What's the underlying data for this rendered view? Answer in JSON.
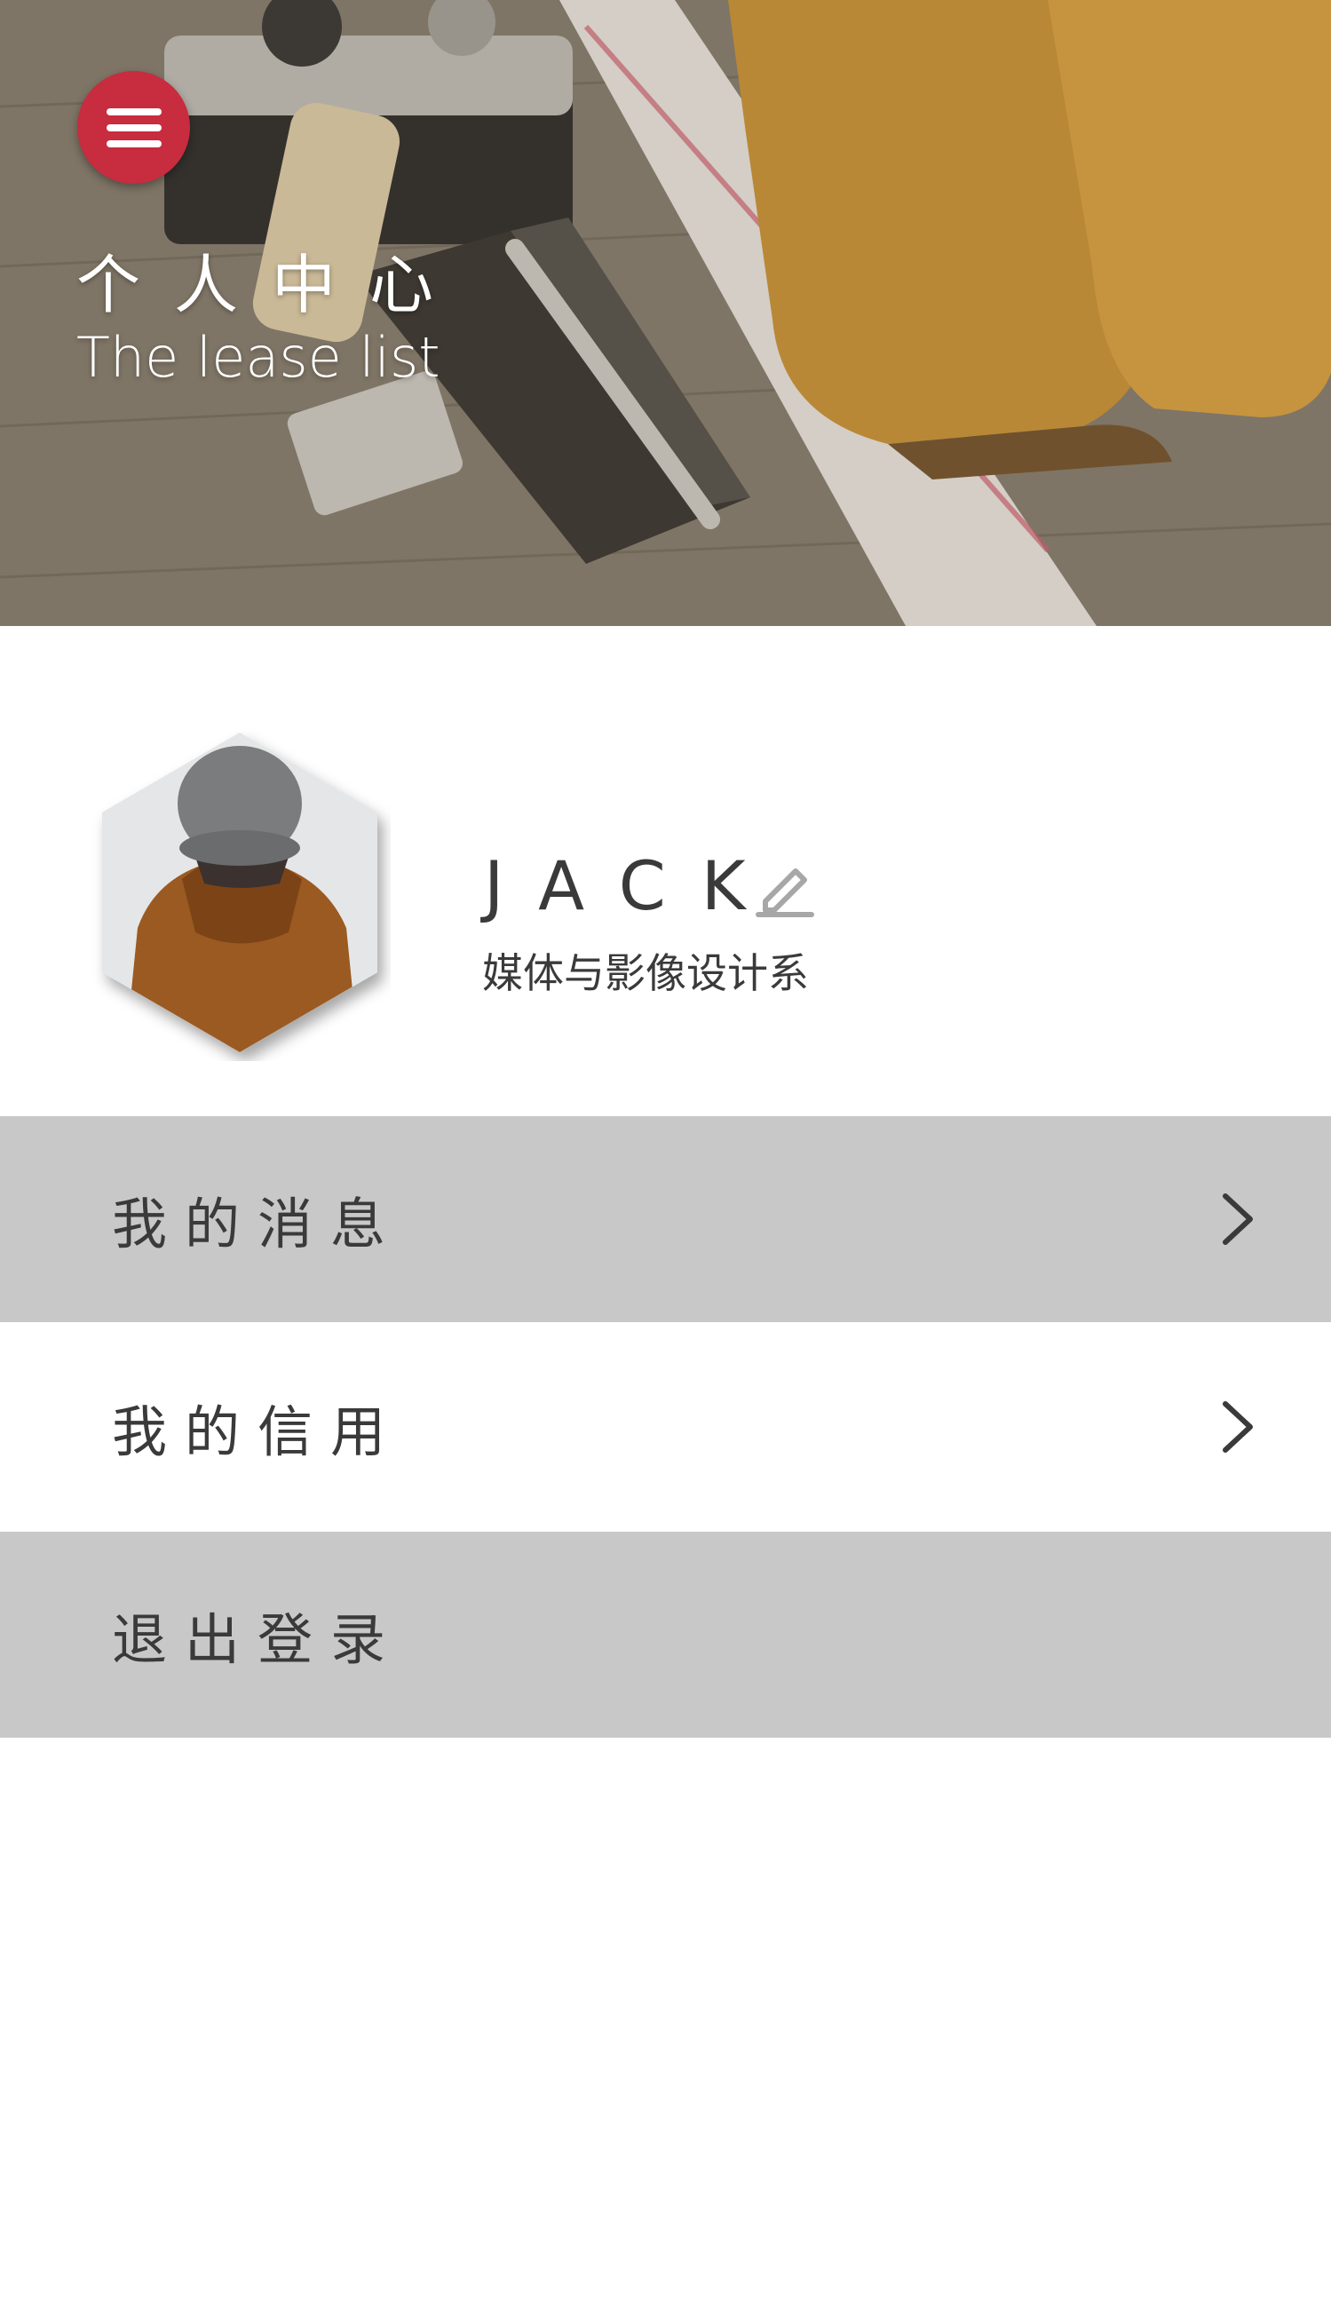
{
  "header": {
    "title": "个人中心",
    "subtitle": "The lease list",
    "menu_icon": "hamburger-menu-icon",
    "accent_color": "#c72c3f"
  },
  "profile": {
    "name": "JACK",
    "department": "媒体与影像设计系",
    "avatar_icon": "user-avatar",
    "edit_icon": "pencil-edit-icon"
  },
  "menu": {
    "messages_label": "我的消息",
    "credit_label": "我的信用",
    "logout_label": "退出登录",
    "chevron_icon": "chevron-right-icon",
    "row_gray_color": "#c7c8c7"
  }
}
